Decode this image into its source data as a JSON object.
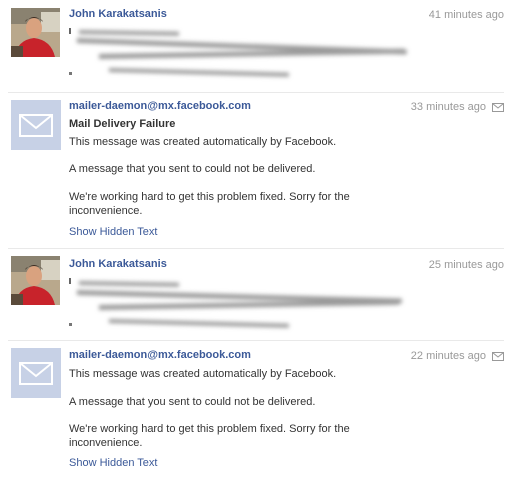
{
  "messages": [
    {
      "author": "John Karakatsanis",
      "time": "41 minutes ago",
      "redacted": true
    },
    {
      "author": "mailer-daemon@mx.facebook.com",
      "time": "33 minutes ago",
      "subject": "Mail Delivery Failure",
      "body": [
        "This message was created automatically by Facebook.",
        "A message that you sent to  could not be delivered.",
        "We're working hard to get this problem fixed. Sorry for the",
        "inconvenience."
      ],
      "link": "Show Hidden Text"
    },
    {
      "author": "John Karakatsanis",
      "time": "25 minutes ago",
      "redacted": true
    },
    {
      "author": "mailer-daemon@mx.facebook.com",
      "time": "22 minutes ago",
      "body": [
        "This message was created automatically by Facebook.",
        "A message that you sent to  could not be delivered.",
        "We're working hard to get this problem fixed. Sorry for the",
        "inconvenience."
      ],
      "link": "Show Hidden Text"
    }
  ],
  "colors": {
    "link": "#3b5998",
    "timestamp": "#999999",
    "avatar_placeholder": "#c7d1e6"
  },
  "icons": [
    "envelope-icon",
    "default-mail-avatar-icon",
    "user-photo-avatar"
  ]
}
